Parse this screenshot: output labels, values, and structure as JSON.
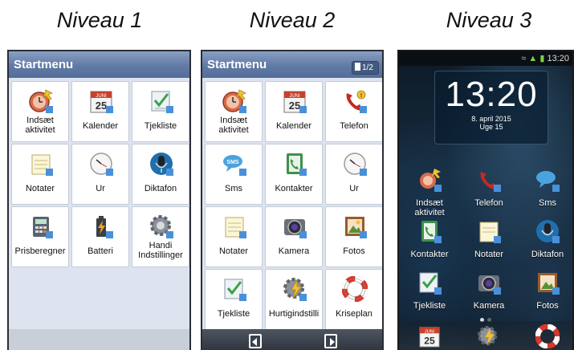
{
  "levels": {
    "level1": "Niveau 1",
    "level2": "Niveau 2",
    "level3": "Niveau 3"
  },
  "phone1": {
    "title": "Startmenu",
    "tiles": [
      {
        "label": "Indsæt aktivitet",
        "icon": "add-activity-icon"
      },
      {
        "label": "Kalender",
        "icon": "calendar-icon",
        "calendar_month": "JUNI",
        "calendar_day": "25"
      },
      {
        "label": "Tjekliste",
        "icon": "checklist-icon"
      },
      {
        "label": "Notater",
        "icon": "notes-icon"
      },
      {
        "label": "Ur",
        "icon": "clock-icon"
      },
      {
        "label": "Diktafon",
        "icon": "microphone-icon"
      },
      {
        "label": "Prisberegner",
        "icon": "calculator-icon"
      },
      {
        "label": "Batteri",
        "icon": "battery-icon"
      },
      {
        "label": "Handi Indstillinger",
        "icon": "settings-gear-icon"
      }
    ]
  },
  "phone2": {
    "title": "Startmenu",
    "page_indicator": "1/2",
    "tiles": [
      {
        "label": "Indsæt aktivitet",
        "icon": "add-activity-icon"
      },
      {
        "label": "Kalender",
        "icon": "calendar-icon",
        "calendar_month": "JUNI",
        "calendar_day": "25"
      },
      {
        "label": "Telefon",
        "icon": "phone-icon"
      },
      {
        "label": "Sms",
        "icon": "sms-icon",
        "bubble_text": "SMS"
      },
      {
        "label": "Kontakter",
        "icon": "contacts-icon"
      },
      {
        "label": "Ur",
        "icon": "clock-icon"
      },
      {
        "label": "Notater",
        "icon": "notes-icon"
      },
      {
        "label": "Kamera",
        "icon": "camera-icon"
      },
      {
        "label": "Fotos",
        "icon": "photos-icon"
      },
      {
        "label": "Tjekliste",
        "icon": "checklist-icon"
      },
      {
        "label": "Hurtigindstilli",
        "icon": "quick-settings-icon"
      },
      {
        "label": "Kriseplan",
        "icon": "lifebuoy-icon"
      }
    ]
  },
  "phone3": {
    "status_time": "13:20",
    "clock": {
      "time": "13:20",
      "date": "8. april 2015",
      "week": "Uge 15"
    },
    "icons": [
      {
        "label": "Indsæt aktivitet",
        "icon": "add-activity-icon"
      },
      {
        "label": "Telefon",
        "icon": "phone-icon"
      },
      {
        "label": "Sms",
        "icon": "sms-icon"
      },
      {
        "label": "Kontakter",
        "icon": "contacts-icon"
      },
      {
        "label": "Notater",
        "icon": "notes-icon"
      },
      {
        "label": "Diktafon",
        "icon": "microphone-icon"
      },
      {
        "label": "Tjekliste",
        "icon": "checklist-icon"
      },
      {
        "label": "Kamera",
        "icon": "camera-icon"
      },
      {
        "label": "Fotos",
        "icon": "photos-icon"
      }
    ],
    "dock_calendar_month": "JUNI",
    "dock_calendar_day": "25"
  }
}
